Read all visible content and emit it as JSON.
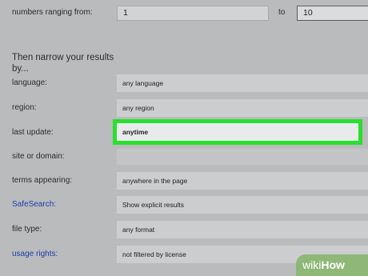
{
  "range": {
    "label": "numbers ranging from:",
    "from_value": "1",
    "to_label": "to",
    "to_value": "10"
  },
  "narrow": {
    "heading": "Then narrow your results by..."
  },
  "fields": {
    "language": {
      "label": "language:",
      "value": "any language"
    },
    "region": {
      "label": "region:",
      "value": "any region"
    },
    "last_update": {
      "label": "last update:",
      "value": "anytime"
    },
    "site_or_domain": {
      "label": "site or domain:",
      "value": ""
    },
    "terms_appearing": {
      "label": "terms appearing:",
      "value": "anywhere in the page"
    },
    "safesearch": {
      "label": "SafeSearch:",
      "value": "Show explicit results"
    },
    "file_type": {
      "label": "file type:",
      "value": "any format"
    },
    "usage_rights": {
      "label": "usage rights:",
      "value": "not filtered by license"
    }
  },
  "colors": {
    "highlight": "#29e02f",
    "link": "#1f3ca8",
    "watermark": "#8fb777"
  },
  "watermark": {
    "wiki": "wiki",
    "how": "How"
  }
}
